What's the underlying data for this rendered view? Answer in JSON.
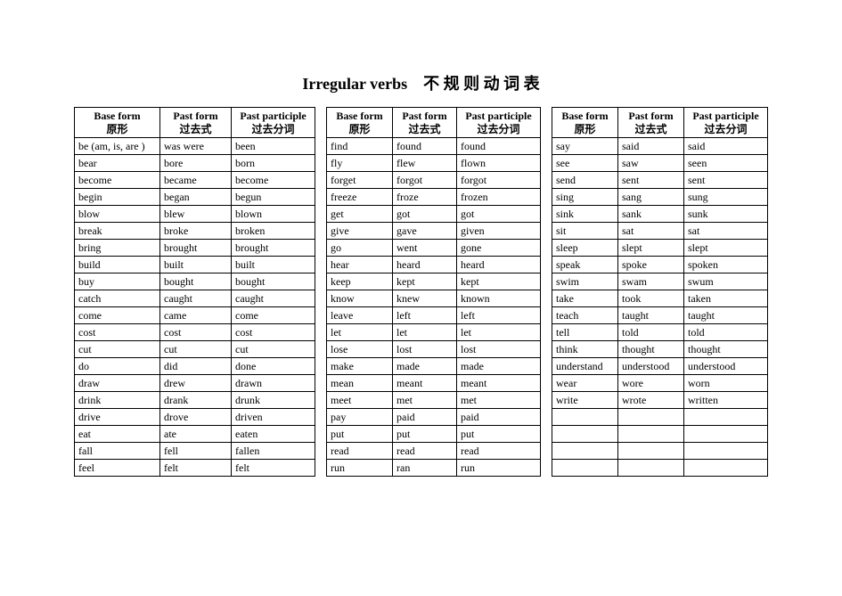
{
  "title": "Irregular verbs    不 规 则 动 词 表",
  "headers": {
    "base_en": "Base form",
    "base_cn": "原形",
    "past_en": "Past form",
    "past_cn": "过去式",
    "pp_en": "Past participle",
    "pp_cn": "过去分词"
  },
  "table1_rows": [
    [
      "be (am, is, are )",
      "was    were",
      "been"
    ],
    [
      "bear",
      "bore",
      "born"
    ],
    [
      "become",
      "became",
      "become"
    ],
    [
      "begin",
      "began",
      "begun"
    ],
    [
      "blow",
      "blew",
      "blown"
    ],
    [
      "break",
      "broke",
      "broken"
    ],
    [
      "bring",
      "brought",
      "brought"
    ],
    [
      "build",
      "built",
      "built"
    ],
    [
      "buy",
      "bought",
      "bought"
    ],
    [
      "catch",
      "caught",
      "caught"
    ],
    [
      "come",
      "came",
      "come"
    ],
    [
      "cost",
      "cost",
      "cost"
    ],
    [
      "cut",
      "cut",
      "cut"
    ],
    [
      "do",
      "did",
      "done"
    ],
    [
      "draw",
      "drew",
      "drawn"
    ],
    [
      "drink",
      "drank",
      "drunk"
    ],
    [
      "drive",
      "drove",
      "driven"
    ],
    [
      "eat",
      "ate",
      "eaten"
    ],
    [
      "fall",
      "fell",
      "fallen"
    ],
    [
      "feel",
      "felt",
      "felt"
    ]
  ],
  "table2_rows": [
    [
      "find",
      "found",
      "found"
    ],
    [
      "fly",
      "flew",
      "flown"
    ],
    [
      "forget",
      "forgot",
      "forgot"
    ],
    [
      "freeze",
      "froze",
      "frozen"
    ],
    [
      "get",
      "got",
      "got"
    ],
    [
      "give",
      "gave",
      "given"
    ],
    [
      "go",
      "went",
      "gone"
    ],
    [
      "hear",
      "heard",
      "heard"
    ],
    [
      "keep",
      "kept",
      "kept"
    ],
    [
      "know",
      "knew",
      "known"
    ],
    [
      "leave",
      "left",
      "left"
    ],
    [
      "let",
      "let",
      "let"
    ],
    [
      "lose",
      "lost",
      "lost"
    ],
    [
      "make",
      "made",
      "made"
    ],
    [
      "mean",
      "meant",
      "meant"
    ],
    [
      "meet",
      "met",
      "met"
    ],
    [
      "pay",
      "paid",
      "paid"
    ],
    [
      "put",
      "put",
      "put"
    ],
    [
      "read",
      "read",
      "read"
    ],
    [
      "run",
      "ran",
      "run"
    ]
  ],
  "table3_rows": [
    [
      "say",
      "said",
      "said"
    ],
    [
      "see",
      "saw",
      "seen"
    ],
    [
      "send",
      "sent",
      "sent"
    ],
    [
      "sing",
      "sang",
      "sung"
    ],
    [
      "sink",
      "sank",
      "sunk"
    ],
    [
      "sit",
      "sat",
      "sat"
    ],
    [
      "sleep",
      "slept",
      "slept"
    ],
    [
      "speak",
      "spoke",
      "spoken"
    ],
    [
      "swim",
      "swam",
      "swum"
    ],
    [
      "take",
      "took",
      "taken"
    ],
    [
      "teach",
      "taught",
      "taught"
    ],
    [
      "tell",
      "told",
      "told"
    ],
    [
      "think",
      "thought",
      "thought"
    ],
    [
      "understand",
      "understood",
      "understood"
    ],
    [
      "wear",
      "wore",
      "worn"
    ],
    [
      "write",
      "wrote",
      "written"
    ],
    [
      "",
      "",
      ""
    ],
    [
      "",
      "",
      ""
    ],
    [
      "",
      "",
      ""
    ],
    [
      "",
      "",
      ""
    ]
  ]
}
